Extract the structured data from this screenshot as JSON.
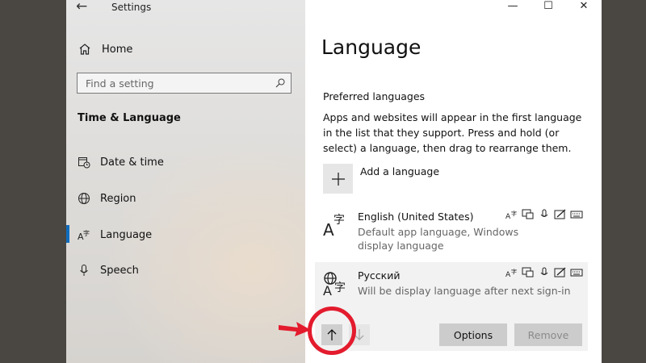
{
  "window": {
    "title": "Settings",
    "minimize": "—",
    "maximize": "☐",
    "close": "✕"
  },
  "nav": {
    "home": "Home",
    "search_placeholder": "Find a setting",
    "section_title": "Time & Language",
    "items": [
      {
        "label": "Date & time",
        "icon": "calendar-clock-icon"
      },
      {
        "label": "Region",
        "icon": "globe-icon"
      },
      {
        "label": "Language",
        "icon": "language-icon",
        "selected": true
      },
      {
        "label": "Speech",
        "icon": "microphone-icon"
      }
    ]
  },
  "content": {
    "title": "Language",
    "preferred_heading": "Preferred languages",
    "description": "Apps and websites will appear in the first language in the list that they support. Press and hold (or select) a language, then drag to rearrange them.",
    "add_language": "Add a language",
    "languages": [
      {
        "name": "English (United States)",
        "detail": "Default app language, Windows display language"
      },
      {
        "name": "Русский",
        "detail": "Will be display language after next sign-in"
      }
    ],
    "buttons": {
      "options": "Options",
      "remove": "Remove"
    }
  },
  "colors": {
    "accent": "#0f6cbd",
    "annotation_red": "#e31b2d",
    "button_gray": "#cccccc"
  }
}
